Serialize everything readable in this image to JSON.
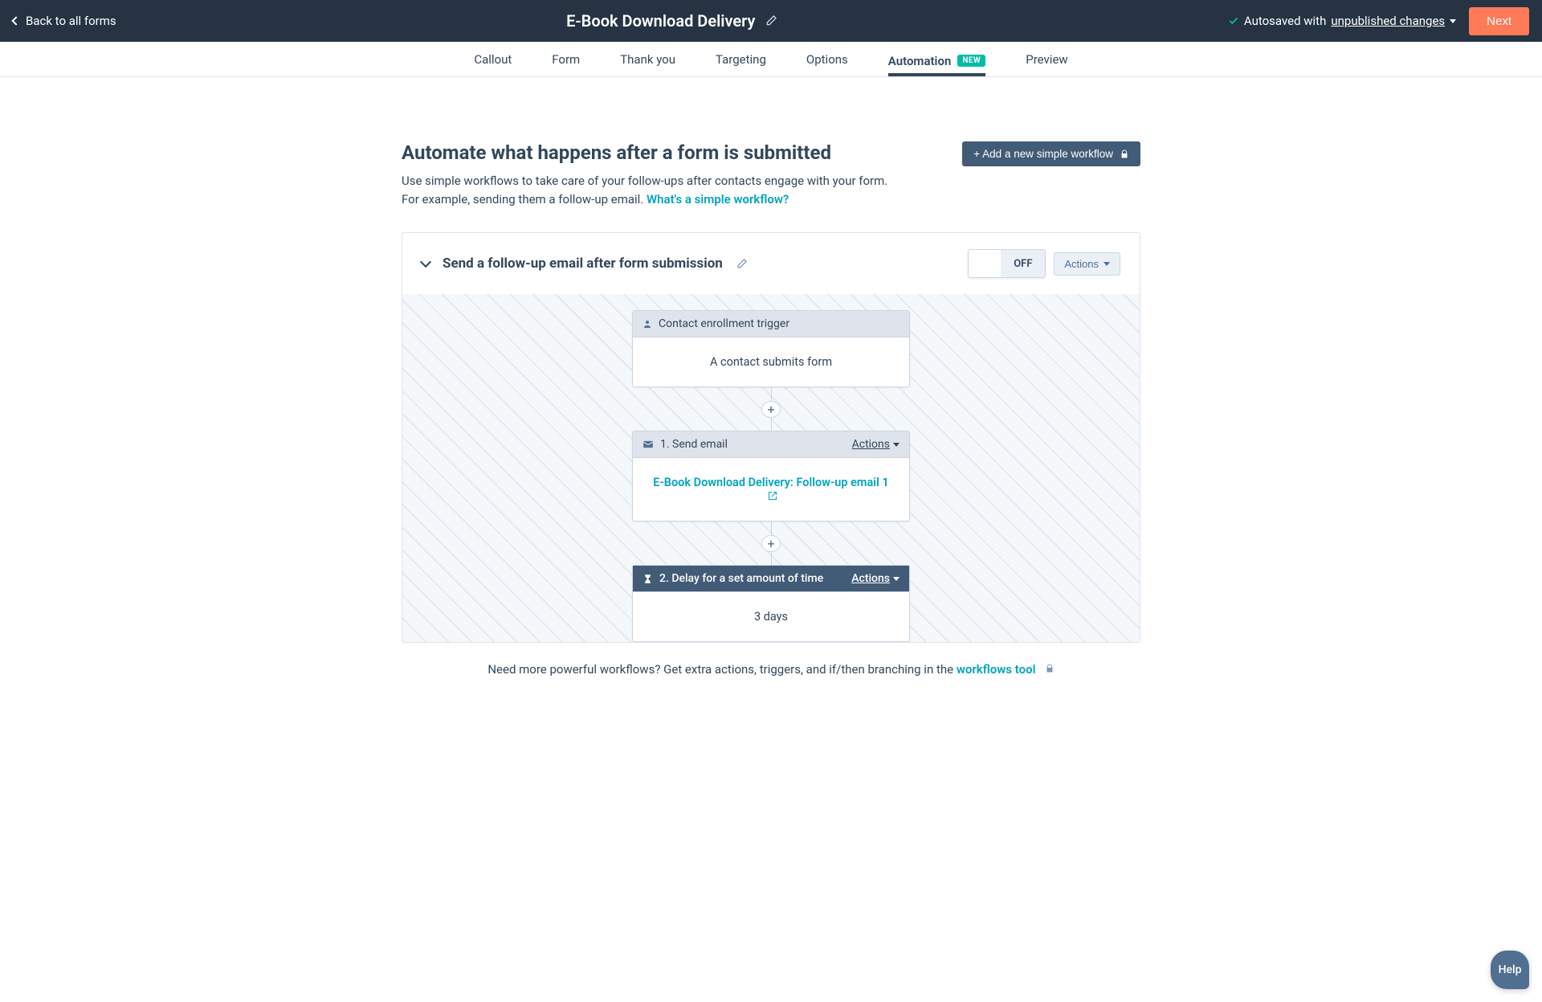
{
  "header": {
    "back_label": "Back to all forms",
    "title": "E-Book Download Delivery",
    "autosave_prefix": "Autosaved with ",
    "autosave_link": "unpublished changes",
    "next_label": "Next"
  },
  "tabs": [
    {
      "label": "Callout"
    },
    {
      "label": "Form"
    },
    {
      "label": "Thank you"
    },
    {
      "label": "Targeting"
    },
    {
      "label": "Options"
    },
    {
      "label": "Automation",
      "active": true,
      "badge": "NEW"
    },
    {
      "label": "Preview"
    }
  ],
  "section": {
    "title": "Automate what happens after a form is submitted",
    "lede": "Use simple workflows to take care of your follow-ups after contacts engage with your form. For example, sending them a follow-up email.  ",
    "link": "What's a simple workflow?",
    "add_btn": "+ Add a new simple workflow"
  },
  "workflow": {
    "title": "Send a follow-up email after form submission",
    "toggle_state": "OFF",
    "actions_label": "Actions"
  },
  "nodes": {
    "trigger": {
      "head": "Contact enrollment trigger",
      "body": "A contact submits form"
    },
    "step1": {
      "head": "1. Send email",
      "actions": "Actions",
      "body_link": "E-Book Download Delivery: Follow-up email 1"
    },
    "step2": {
      "head": "2. Delay for a set amount of time",
      "actions": "Actions",
      "body": "3 days"
    }
  },
  "footer": {
    "text_a": "Need more powerful workflows? Get extra actions, triggers, and if/then branching in the ",
    "link": "workflows tool"
  },
  "help": {
    "label": "Help"
  }
}
